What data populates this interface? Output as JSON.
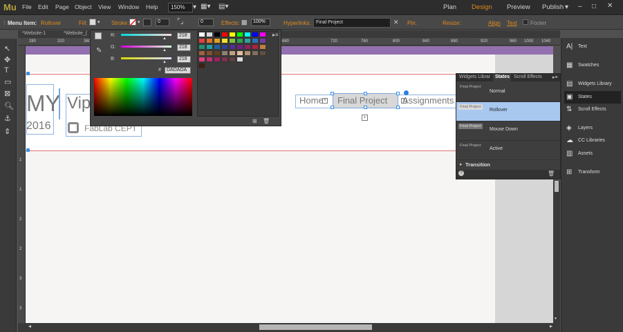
{
  "app": {
    "logo": "Mu"
  },
  "menu": [
    "File",
    "Edit",
    "Page",
    "Object",
    "View",
    "Window",
    "Help"
  ],
  "zoom": "150%",
  "modes": {
    "plan": "Plan",
    "design": "Design",
    "preview": "Preview",
    "publish": "Publish"
  },
  "control": {
    "menu_item_label": "Menu Item:",
    "menu_item_value": "Rollover",
    "fill": "Fill:",
    "stroke": "Stroke:",
    "stroke_w": "0",
    "corner_w": "0",
    "effects": "Effects:",
    "opacity": "100%",
    "hyperlinks": "Hyperlinks:",
    "hyperlink_value": "Final Project",
    "pin": "Pin:",
    "resize": "Resize:",
    "align": "Align",
    "text": "Text",
    "footer": "Footer"
  },
  "tabs": [
    "*Website-1",
    "*Website_("
  ],
  "ruler": {
    "h": [
      "280",
      "320",
      "360",
      "680",
      "720",
      "760",
      "800",
      "840",
      "880",
      "920",
      "960",
      "1000",
      "1040"
    ],
    "v": [
      "1",
      "1",
      "2",
      "2",
      "3",
      "3"
    ]
  },
  "canvas": {
    "my": "MY",
    "year": "2016",
    "vip": "Vip",
    "fablab": "FabLab CEPT",
    "nav": [
      "Home",
      "Final Project",
      "Assignments"
    ]
  },
  "picker": {
    "r": "R:",
    "g": "G:",
    "b": "B:",
    "r_val": "218",
    "g_val": "218",
    "b_val": "218",
    "hash": "#",
    "hex": "DADADA",
    "swatches": [
      [
        "#ffffff",
        "#d8d8d8",
        "#000000",
        "#ff0000",
        "#ffff00",
        "#00ff00",
        "#00ffff",
        "#0000ff",
        "#ff00ff"
      ],
      [
        "#e04040",
        "#e07030",
        "#e0a020",
        "#f0e030",
        "#80c040",
        "#30a050",
        "#30a0a0",
        "#3070c0",
        "#7040a0"
      ],
      [
        "#209070",
        "#20a0a0",
        "#2060a0",
        "#304090",
        "#503090",
        "#702080",
        "#902060",
        "#b02040",
        "#c08040"
      ],
      [
        "#a06040",
        "#805030",
        "#604020",
        "#908070",
        "#c0a080",
        "#e0c0a0",
        "#b09070",
        "#807060",
        "#605040"
      ],
      [
        "#e04080",
        "#c03070",
        "#a02060",
        "#803050",
        "#604040",
        "#dadada"
      ],
      [
        "#402010"
      ]
    ]
  },
  "states": {
    "tabs": [
      "Widgets Librar",
      "States",
      "Scroll Effects"
    ],
    "thumb": "Final Project",
    "rows": [
      "Normal",
      "Rollover",
      "Mouse Down",
      "Active"
    ],
    "transition": "Transition",
    "help": "?"
  },
  "rpanel": [
    "Text",
    "Swatches",
    "Widgets Library",
    "States",
    "Scroll Effects",
    "Layers",
    "CC Libraries",
    "Assets",
    "Transform"
  ],
  "colors": {
    "accent": "#e08a1c",
    "selected_row": "#a8c8f0",
    "menu_purple": "#9370b0"
  }
}
